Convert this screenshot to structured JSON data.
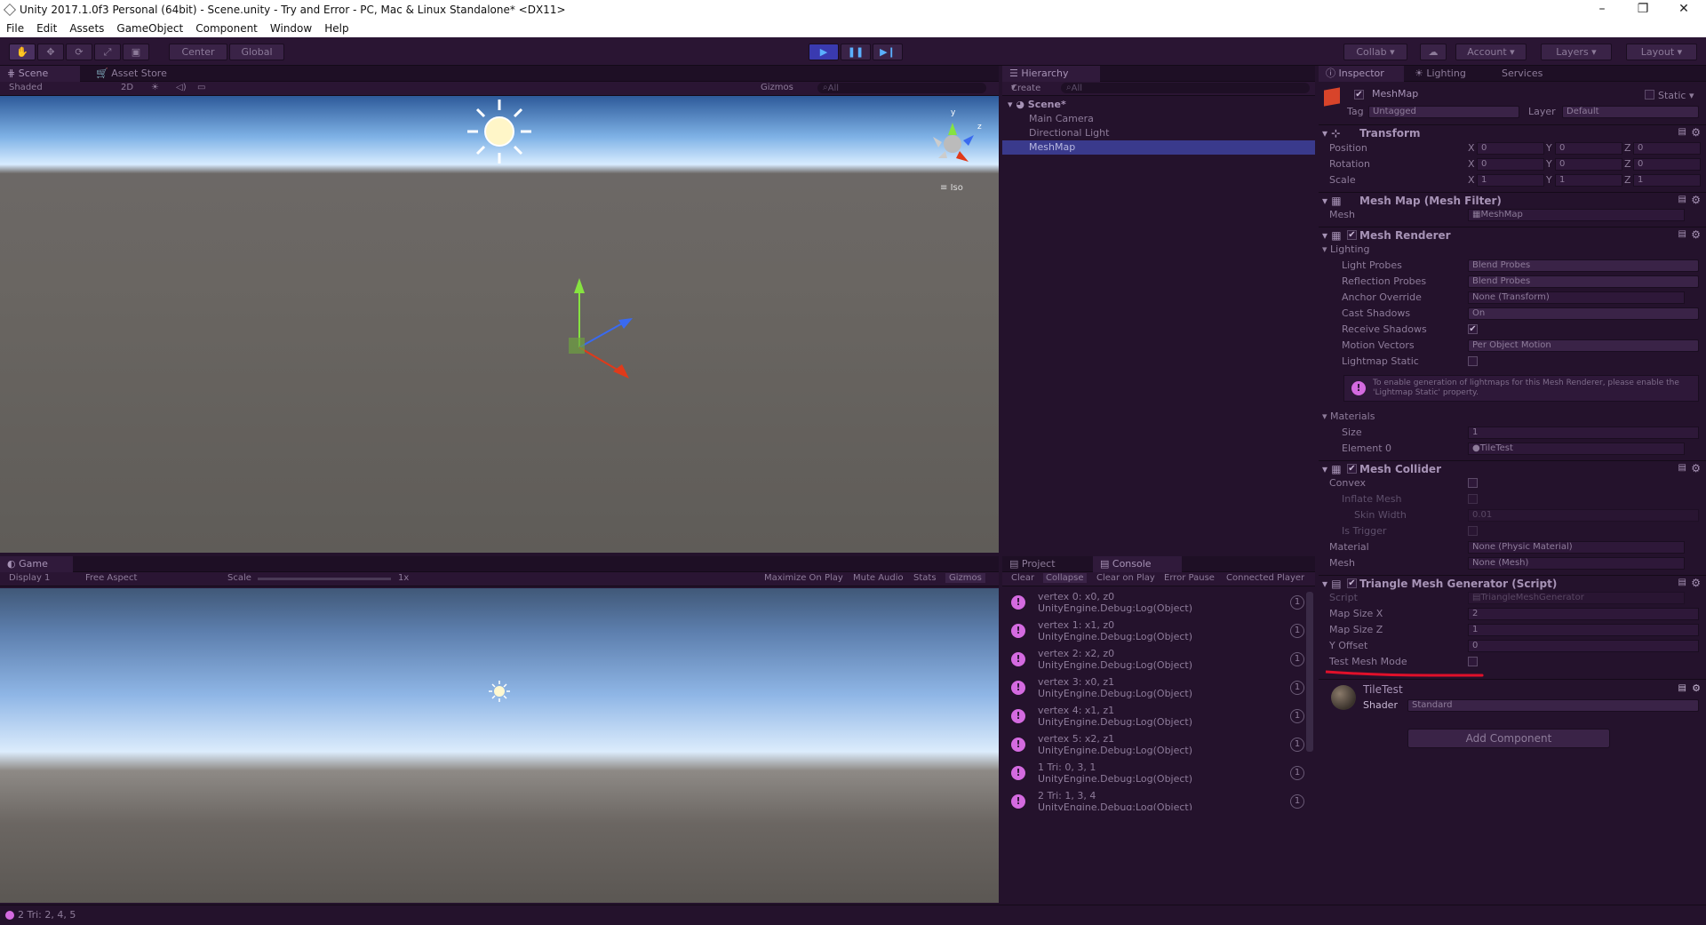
{
  "title": "Unity 2017.1.0f3 Personal (64bit) - Scene.unity - Try and Error - PC, Mac & Linux Standalone* <DX11>",
  "menu": [
    "File",
    "Edit",
    "Assets",
    "GameObject",
    "Component",
    "Window",
    "Help"
  ],
  "toolbar": {
    "center": "Center",
    "global": "Global",
    "collab": "Collab",
    "account": "Account",
    "layers": "Layers",
    "layout": "Layout"
  },
  "scene": {
    "tab": "Scene",
    "asset_store": "Asset Store",
    "shaded": "Shaded",
    "twod": "2D",
    "gizmos": "Gizmos",
    "search": "All",
    "iso": "Iso",
    "gizmo_y": "y",
    "gizmo_z": "z"
  },
  "game": {
    "tab": "Game",
    "display": "Display 1",
    "aspect": "Free Aspect",
    "scale_label": "Scale",
    "scale_value": "1x",
    "maximize": "Maximize On Play",
    "mute": "Mute Audio",
    "stats": "Stats",
    "gizmos": "Gizmos"
  },
  "hierarchy": {
    "tab": "Hierarchy",
    "create": "Create",
    "search": "All",
    "scene": "Scene*",
    "items": [
      "Main Camera",
      "Directional Light",
      "MeshMap"
    ]
  },
  "console": {
    "project_tab": "Project",
    "console_tab": "Console",
    "buttons": [
      "Clear",
      "Collapse",
      "Clear on Play",
      "Error Pause",
      "Connected Player"
    ],
    "entries": [
      {
        "l1": "vertex 0: x0, z0",
        "l2": "UnityEngine.Debug:Log(Object)",
        "count": "1"
      },
      {
        "l1": "vertex 1: x1, z0",
        "l2": "UnityEngine.Debug:Log(Object)",
        "count": "1"
      },
      {
        "l1": "vertex 2: x2, z0",
        "l2": "UnityEngine.Debug:Log(Object)",
        "count": "1"
      },
      {
        "l1": "vertex 3: x0, z1",
        "l2": "UnityEngine.Debug:Log(Object)",
        "count": "1"
      },
      {
        "l1": "vertex 4: x1, z1",
        "l2": "UnityEngine.Debug:Log(Object)",
        "count": "1"
      },
      {
        "l1": "vertex 5: x2, z1",
        "l2": "UnityEngine.Debug:Log(Object)",
        "count": "1"
      },
      {
        "l1": "1 Tri: 0, 3, 1",
        "l2": "UnityEngine.Debug:Log(Object)",
        "count": "1"
      },
      {
        "l1": "2 Tri: 1, 3, 4",
        "l2": "UnityEngine.Debug:Log(Object)",
        "count": "1"
      }
    ]
  },
  "inspector": {
    "tabs": [
      "Inspector",
      "Lighting",
      "Services"
    ],
    "object_name": "MeshMap",
    "static": "Static",
    "tag_label": "Tag",
    "tag": "Untagged",
    "layer_label": "Layer",
    "layer": "Default",
    "transform": {
      "title": "Transform",
      "rows": [
        {
          "label": "Position",
          "x": "0",
          "y": "0",
          "z": "0"
        },
        {
          "label": "Rotation",
          "x": "0",
          "y": "0",
          "z": "0"
        },
        {
          "label": "Scale",
          "x": "1",
          "y": "1",
          "z": "1"
        }
      ],
      "axis": [
        "X",
        "Y",
        "Z"
      ]
    },
    "mesh_filter": {
      "title": "Mesh Map (Mesh Filter)",
      "mesh_label": "Mesh",
      "mesh": "MeshMap"
    },
    "mesh_renderer": {
      "title": "Mesh Renderer",
      "lighting": "Lighting",
      "rows": [
        {
          "label": "Light Probes",
          "value": "Blend Probes"
        },
        {
          "label": "Reflection Probes",
          "value": "Blend Probes"
        },
        {
          "label": "Anchor Override",
          "value": "None (Transform)"
        },
        {
          "label": "Cast Shadows",
          "value": "On"
        },
        {
          "label": "Receive Shadows",
          "value": "✔"
        },
        {
          "label": "Motion Vectors",
          "value": "Per Object Motion"
        },
        {
          "label": "Lightmap Static",
          "value": ""
        }
      ],
      "info": "To enable generation of lightmaps for this Mesh Renderer, please enable the 'Lightmap Static' property.",
      "materials": "Materials",
      "size_label": "Size",
      "size": "1",
      "element_label": "Element 0",
      "element": "TileTest"
    },
    "mesh_collider": {
      "title": "Mesh Collider",
      "convex": "Convex",
      "inflate": "Inflate Mesh",
      "skin_label": "Skin Width",
      "skin": "0.01",
      "trigger": "Is Trigger",
      "material_label": "Material",
      "material": "None (Physic Material)",
      "mesh_label": "Mesh",
      "mesh": "None (Mesh)"
    },
    "script": {
      "title": "Triangle Mesh Generator (Script)",
      "script_label": "Script",
      "script": "TriangleMeshGenerator",
      "rows": [
        {
          "label": "Map Size X",
          "value": "2"
        },
        {
          "label": "Map Size Z",
          "value": "1"
        },
        {
          "label": "Y Offset",
          "value": "0"
        },
        {
          "label": "Test Mesh Mode",
          "value": ""
        }
      ]
    },
    "material": {
      "name": "TileTest",
      "shader_label": "Shader",
      "shader": "Standard"
    },
    "add_component": "Add Component"
  },
  "status": "2 Tri: 2, 4, 5",
  "colors": {
    "accent": "#3a3a8c",
    "annotation": "#e0102a",
    "log_icon": "#d46ae0"
  }
}
